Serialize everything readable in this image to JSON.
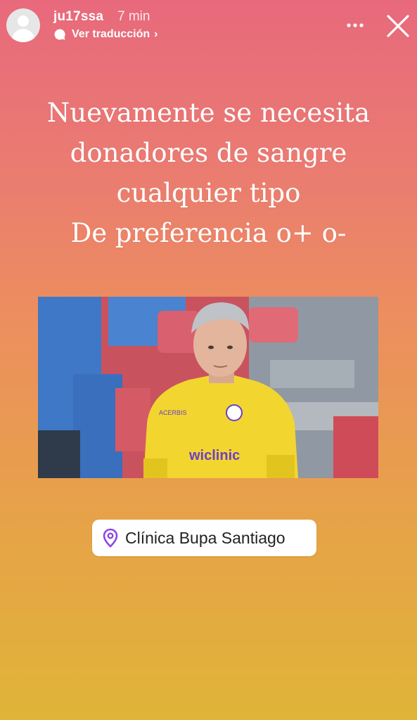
{
  "story": {
    "username": "ju17ssa",
    "time": "7 min",
    "translate_label": "Ver traducción",
    "translate_chevron": "›"
  },
  "icons": {
    "avatar": "default-avatar-icon",
    "translate": "speech-bubble-icon",
    "more": "more-options-icon",
    "close": "close-icon",
    "location": "location-pin-icon"
  },
  "content": {
    "headline_lines": [
      "Nuevamente se necesita",
      "donadores de sangre",
      "cualquier tipo",
      "De preferencia o+ o-"
    ],
    "location_sticker": "Clínica Bupa Santiago"
  },
  "colors": {
    "gradient_top": "#e8697c",
    "gradient_bottom": "#e0b437",
    "pin": "#8e44e4",
    "jersey": "#f3d530",
    "sponsor_text": "#6a3fc6"
  },
  "photo": {
    "jersey_brand": "ACERBIS",
    "sponsor": "wiclinic"
  }
}
